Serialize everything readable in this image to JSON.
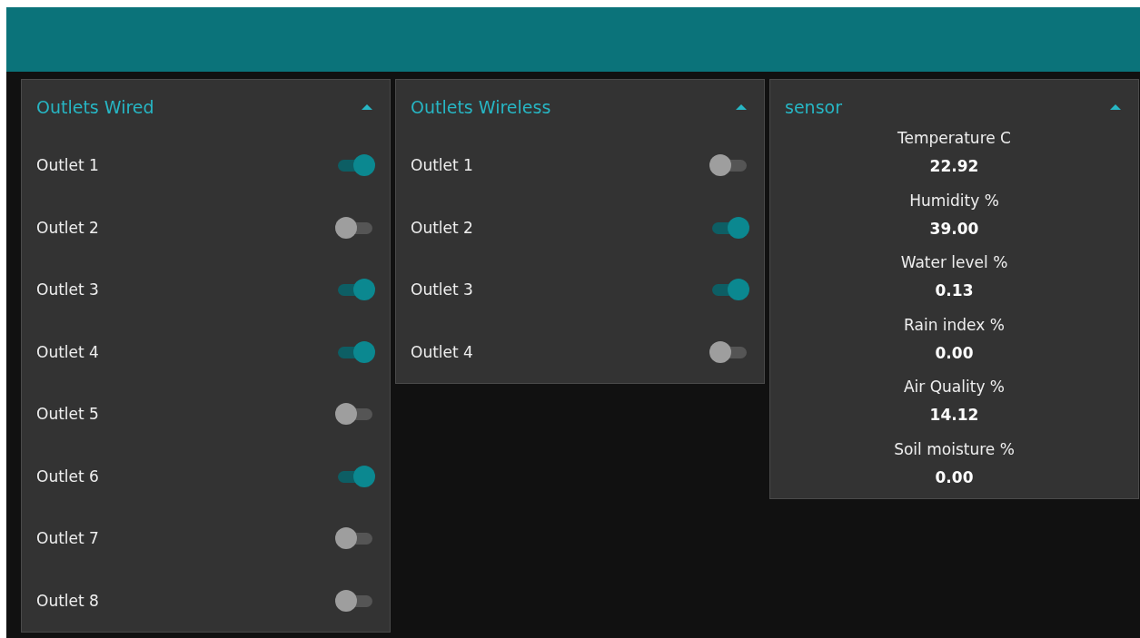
{
  "groups": [
    {
      "title": "Outlets Wired",
      "kind": "switches",
      "items": [
        {
          "label": "Outlet 1",
          "on": true
        },
        {
          "label": "Outlet 2",
          "on": false
        },
        {
          "label": "Outlet 3",
          "on": true
        },
        {
          "label": "Outlet 4",
          "on": true
        },
        {
          "label": "Outlet 5",
          "on": false
        },
        {
          "label": "Outlet 6",
          "on": true
        },
        {
          "label": "Outlet 7",
          "on": false
        },
        {
          "label": "Outlet 8",
          "on": false
        }
      ]
    },
    {
      "title": "Outlets Wireless",
      "kind": "switches",
      "items": [
        {
          "label": "Outlet 1",
          "on": false
        },
        {
          "label": "Outlet 2",
          "on": true
        },
        {
          "label": "Outlet 3",
          "on": true
        },
        {
          "label": "Outlet 4",
          "on": false
        }
      ]
    },
    {
      "title": "sensor",
      "kind": "readings",
      "items": [
        {
          "label": "Temperature C",
          "value": "22.92"
        },
        {
          "label": "Humidity %",
          "value": "39.00"
        },
        {
          "label": "Water level %",
          "value": "0.13"
        },
        {
          "label": "Rain index %",
          "value": "0.00"
        },
        {
          "label": "Air Quality %",
          "value": "14.12"
        },
        {
          "label": "Soil moisture %",
          "value": "0.00"
        }
      ]
    }
  ]
}
